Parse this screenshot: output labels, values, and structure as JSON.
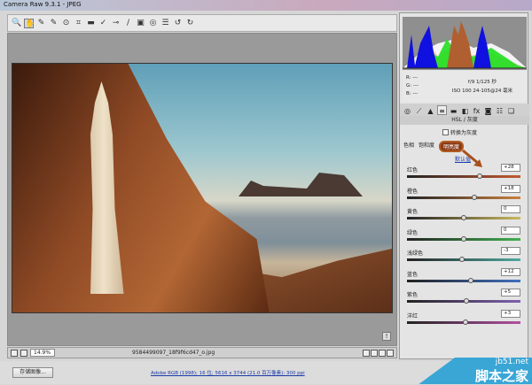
{
  "window": {
    "title": "Camera Raw 9.3.1 - JPEG"
  },
  "toolbar": {
    "tools": [
      "zoom-icon",
      "hand-icon",
      "white-balance-icon",
      "color-sampler-icon",
      "target-adjust-icon",
      "crop-icon",
      "straighten-icon",
      "spot-removal-icon",
      "red-eye-icon",
      "adjustment-brush-icon",
      "graduated-filter-icon",
      "radial-filter-icon",
      "presets-icon",
      "rotate-left-icon",
      "rotate-right-icon"
    ],
    "glyphs": [
      "🔍",
      "✋",
      "✎",
      "✎",
      "⊙",
      "⌗",
      "▬",
      "✓",
      "⊸",
      "/",
      "▣",
      "◎",
      "☰",
      "↺",
      "↻"
    ]
  },
  "canvas": {
    "zoom": "14.9%",
    "filename": "9584499097_18f9f6cd47_o.jpg",
    "warning": "!"
  },
  "footer": {
    "save": "存储图像...",
    "workflow": "Adobe RGB (1998); 16 位; 5616 x 3744 (21.0 百万像素); 300 ppi"
  },
  "histogram": {
    "r": "R: ---",
    "g": "G: ---",
    "b": "B: ---",
    "exposure": "f/9  1/125 秒",
    "iso": "ISO 100  24-105@24 毫米"
  },
  "panel": {
    "tabs": [
      "◎",
      "⟋",
      "▲",
      "≡",
      "▬",
      "◧",
      "fx",
      "◙",
      "☷",
      "❏"
    ],
    "selected_tab": 3,
    "header": "HSL / 灰度",
    "grayscale": "转换为灰度",
    "subtabs": [
      "色相",
      "饱和度",
      "明亮度"
    ],
    "selected_subtab": 2,
    "defaults": "默认值",
    "sliders": [
      {
        "label": "红色",
        "value": "+28",
        "num": 28,
        "track": "linear-gradient(90deg,#222,#c05a30)"
      },
      {
        "label": "橙色",
        "value": "+18",
        "num": 18,
        "track": "linear-gradient(90deg,#222,#c88040)"
      },
      {
        "label": "黄色",
        "value": "0",
        "num": 0,
        "track": "linear-gradient(90deg,#222,#c8b860)"
      },
      {
        "label": "绿色",
        "value": "0",
        "num": 0,
        "track": "linear-gradient(90deg,#222,#40b050)"
      },
      {
        "label": "浅绿色",
        "value": "-3",
        "num": -3,
        "track": "linear-gradient(90deg,#222,#50a8a0)"
      },
      {
        "label": "蓝色",
        "value": "+12",
        "num": 12,
        "track": "linear-gradient(90deg,#222,#4070c0)"
      },
      {
        "label": "紫色",
        "value": "+5",
        "num": 5,
        "track": "linear-gradient(90deg,#222,#8060b0)"
      },
      {
        "label": "洋红",
        "value": "+3",
        "num": 3,
        "track": "linear-gradient(90deg,#222,#b050a0)"
      }
    ]
  },
  "watermark": {
    "line1": "jb51.net",
    "line2": "脚本之家"
  }
}
